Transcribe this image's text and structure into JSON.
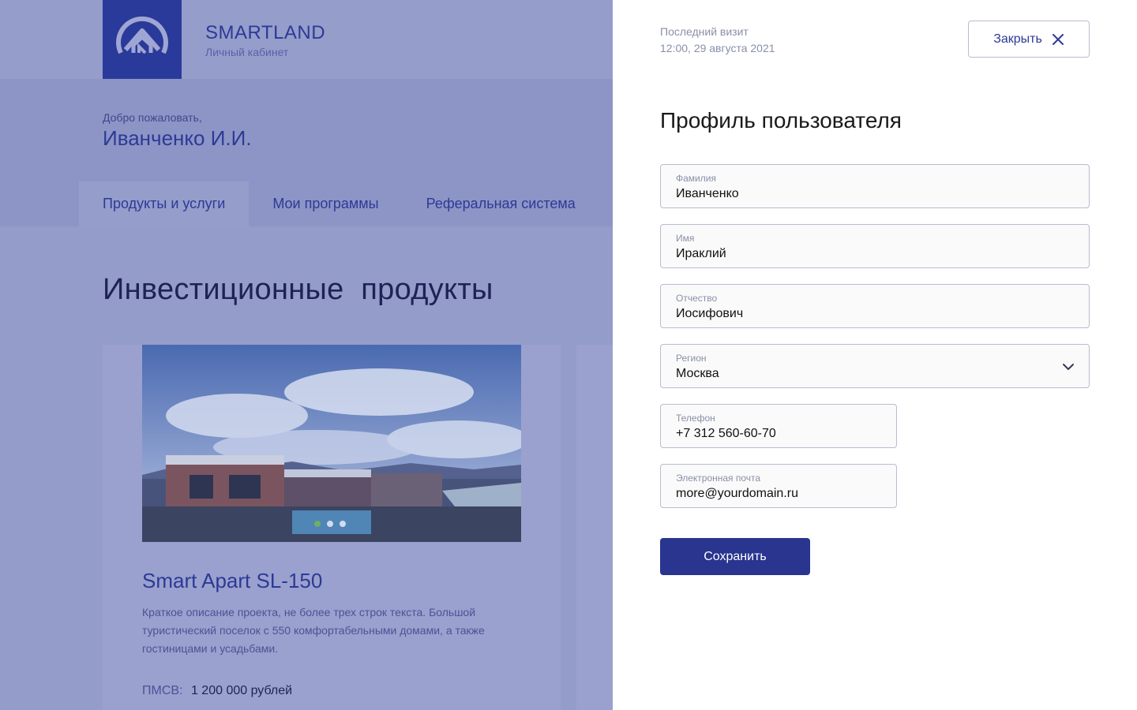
{
  "brand": {
    "name": "SMARTLAND",
    "subtitle": "Личный кабинет"
  },
  "welcome": {
    "greeting": "Добро пожаловать,",
    "user_name": "Иванченко И.И."
  },
  "tabs": [
    {
      "label": "Продукты и услуги",
      "active": true
    },
    {
      "label": "Мои программы",
      "active": false
    },
    {
      "label": "Реферальная система",
      "active": false
    }
  ],
  "section_title": "Инвестиционные  продукты",
  "product_card": {
    "title": "Smart Apart SL-150",
    "description": "Краткое описание проекта, не более трех строк текста. Большой туристический поселок с 550 комфортабельными домами, а также гостиницами и усадьбами.",
    "price_label": "ПМСВ:",
    "price_value": "1 200 000 рублей",
    "carousel": {
      "slides": 3,
      "active_index": 0
    }
  },
  "panel": {
    "last_visit_label": "Последний визит",
    "last_visit_value": "12:00, 29 августа 2021",
    "close_label": "Закрыть",
    "title": "Профиль пользователя",
    "fields": {
      "surname": {
        "label": "Фамилия",
        "value": "Иванченко"
      },
      "name": {
        "label": "Имя",
        "value": "Ираклий"
      },
      "patronymic": {
        "label": "Отчество",
        "value": "Иосифович"
      },
      "region": {
        "label": "Регион",
        "value": "Москва"
      },
      "phone": {
        "label": "Телефон",
        "value": "+7 312 560-60-70"
      },
      "email": {
        "label": "Электронная почта",
        "value": "more@yourdomain.ru"
      }
    },
    "save_label": "Сохранить"
  },
  "icons": {
    "logo": "house-logo-icon",
    "close": "close-icon",
    "region_dropdown": "chevron-down-icon"
  },
  "colors": {
    "brand_primary": "#29358f",
    "overlay_bg": "#949cca",
    "field_border": "#b9bcd0",
    "muted_text": "#8a8fa8"
  }
}
